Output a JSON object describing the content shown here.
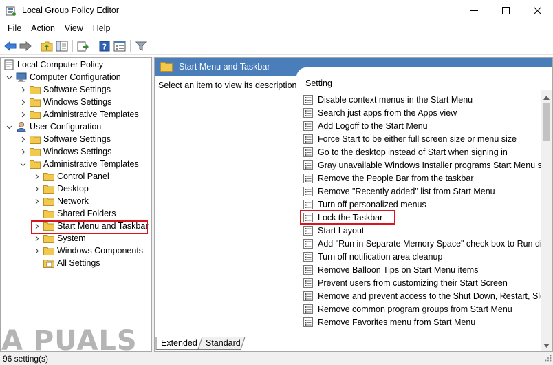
{
  "window": {
    "title": "Local Group Policy Editor",
    "controls": [
      "minimize",
      "maximize",
      "close"
    ]
  },
  "menubar": {
    "items": [
      "File",
      "Action",
      "View",
      "Help"
    ]
  },
  "toolbar": {
    "icons": [
      "back-icon",
      "forward-icon",
      "up-folder-icon",
      "show-hide-tree-icon",
      "export-list-icon",
      "help-icon",
      "properties-icon",
      "filter-icon"
    ]
  },
  "tree": {
    "root": "Local Computer Policy",
    "computer_config": "Computer Configuration",
    "cc_software": "Software Settings",
    "cc_windows": "Windows Settings",
    "cc_admin": "Administrative Templates",
    "user_config": "User Configuration",
    "uc_software": "Software Settings",
    "uc_windows": "Windows Settings",
    "uc_admin": "Administrative Templates",
    "control_panel": "Control Panel",
    "desktop": "Desktop",
    "network": "Network",
    "shared_folders": "Shared Folders",
    "start_menu": "Start Menu and Taskbar",
    "system": "System",
    "windows_components": "Windows Components",
    "all_settings": "All Settings"
  },
  "main": {
    "header_title": "Start Menu and Taskbar",
    "description_prompt": "Select an item to view its description.",
    "column_header": "Setting",
    "settings": [
      "Disable context menus in the Start Menu",
      "Search just apps from the Apps view",
      "Add Logoff to the Start Menu",
      "Force Start to be either full screen size or menu size",
      "Go to the desktop instead of Start when signing in",
      "Gray unavailable Windows Installer programs Start Menu sh...",
      "Remove the People Bar from the taskbar",
      "Remove \"Recently added\" list from Start Menu",
      "Turn off personalized menus",
      "Lock the Taskbar",
      "Start Layout",
      "Add \"Run in Separate Memory Space\" check box to Run dial...",
      "Turn off notification area cleanup",
      "Remove Balloon Tips on Start Menu items",
      "Prevent users from customizing their Start Screen",
      "Remove and prevent access to the Shut Down, Restart, Sleep...",
      "Remove common program groups from Start Menu",
      "Remove Favorites menu from Start Menu"
    ],
    "highlighted_setting": "Lock the Taskbar"
  },
  "tabs": {
    "extended": "Extended",
    "standard": "Standard"
  },
  "status": {
    "text": "96 setting(s)"
  },
  "watermark": {
    "text": "A PUALS"
  },
  "colors": {
    "header_blue": "#4a7ebb",
    "highlight_red": "#d9141e",
    "folder_yellow": "#f2c94c"
  }
}
